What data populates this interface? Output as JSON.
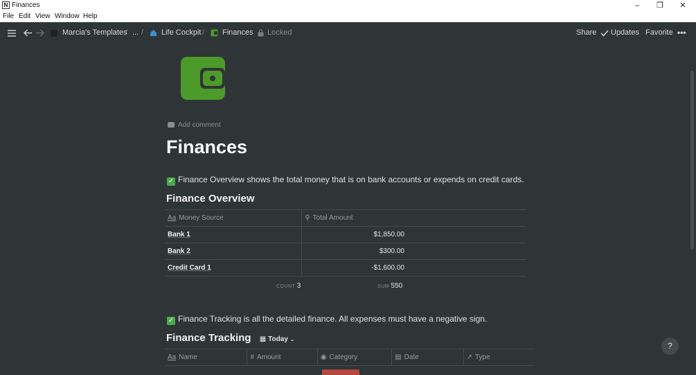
{
  "window": {
    "title": "Finances",
    "app_icon": "N"
  },
  "menu": [
    "File",
    "Edit",
    "View",
    "Window",
    "Help"
  ],
  "breadcrumb": {
    "workspace": "Marcia's Templates",
    "ellipsis": "...",
    "sep": "/",
    "parent": "Life Cockpit",
    "current": "Finances",
    "locked": "Locked"
  },
  "topbar_actions": {
    "share": "Share",
    "updates": "Updates",
    "favorite": "Favorite",
    "more": "•••"
  },
  "page": {
    "add_comment": "Add comment",
    "title": "Finances",
    "callout1": "Finance Overview shows the total money that is on bank accounts or expends on credit cards.",
    "overview_heading": "Finance Overview",
    "overview_table": {
      "columns": [
        "Money Source",
        "Total Amount"
      ],
      "rows": [
        {
          "name": "Bank 1",
          "amount": "$1,850.00"
        },
        {
          "name": "Bank 2",
          "amount": "$300.00"
        },
        {
          "name": "Credit Card 1",
          "amount": "-$1,600.00"
        }
      ],
      "count_label": "COUNT",
      "count_value": "3",
      "sum_label": "SUM",
      "sum_value": "550"
    },
    "callout2": "Finance Tracking is all the detailed finance. All expenses must have a negative sign.",
    "tracking_heading": "Finance Tracking",
    "tracking_view": "Today",
    "tracking_columns": [
      "Name",
      "Amount",
      "Category",
      "Date",
      "Type"
    ]
  },
  "help": "?",
  "colors": {
    "background": "#2f3437",
    "icon_green": "#4c9a2a",
    "check_green": "#4ca84c",
    "category_red": "#b5473e"
  }
}
